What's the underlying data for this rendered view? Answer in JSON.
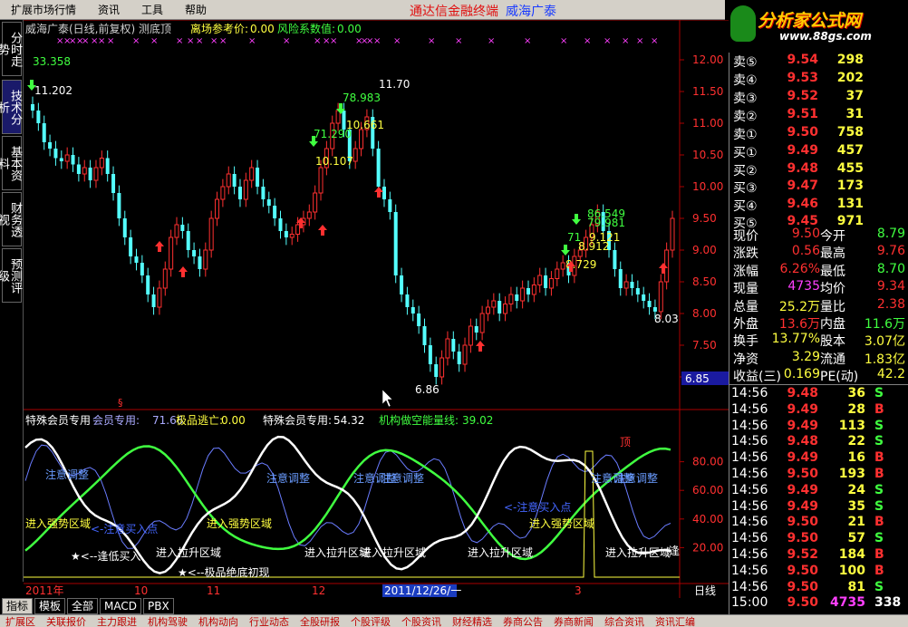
{
  "menu": {
    "items": [
      "扩展市场行情",
      "资讯",
      "工具",
      "帮助"
    ],
    "brand": "通达信金融终端",
    "stock_name": "威海广泰"
  },
  "logo": {
    "text": "分析家公式网",
    "url": "www.88gs.com"
  },
  "left_tabs": [
    "分时走势",
    "技术分析",
    "基本资料",
    "财务透视",
    "预测评级"
  ],
  "chart": {
    "header_title": "威海广泰(日线,前复权) 测底顶",
    "header_line1_label": "离场参考价:",
    "header_line1_value": "0.00",
    "header_line2_label": "风险系数值:",
    "header_line2_value": "0.00",
    "price_axis": [
      "12.00",
      "11.50",
      "11.00",
      "10.50",
      "10.00",
      "9.50",
      "9.00",
      "8.50",
      "8.00",
      "7.50",
      "7.00"
    ],
    "current_price_tag": "6.85",
    "annotations": [
      "33.358",
      "11.202",
      "11.70",
      "78.983",
      "10.661",
      "71.290",
      "10.107",
      "86.549",
      "79.981",
      "9.121",
      "8.912",
      "8.729",
      "71",
      "6.86",
      "8.03"
    ],
    "indicator_title": "特殊会员专用",
    "indicator_line": {
      "label1": "会员专用:",
      "value1": "71.66",
      "label2": "极品逃亡:",
      "value2": "0.00",
      "label3": "特殊会员专用:",
      "value3": "54.32",
      "label4": "机构做空能量线:",
      "value4": "39.02"
    },
    "indicator_axis": [
      "80.00",
      "60.00",
      "40.00",
      "20.00"
    ],
    "indicator_texts": [
      "注意调整",
      "注意调整",
      "注意调整",
      "注意调整",
      "注意调整",
      "注意调整",
      "进入强势区域",
      "进入强势区域",
      "进入强势区域",
      "进入拉升区域",
      "进入拉升区域",
      "进入拉升区域",
      "进入拉升区域",
      "进入拉升区域",
      "<-注意买入点",
      "<-注意买入点",
      "★<--逢低买入",
      "★<--极品绝底初现",
      "顶",
      "逢",
      "§"
    ],
    "date_axis": [
      "2011年",
      "10",
      "11",
      "12",
      "3"
    ],
    "date_selected": "2011/12/26/一",
    "period_label": "日线"
  },
  "quote": {
    "asks": [
      {
        "label": "卖⑤",
        "price": "9.54",
        "vol": "298"
      },
      {
        "label": "卖④",
        "price": "9.53",
        "vol": "202"
      },
      {
        "label": "卖③",
        "price": "9.52",
        "vol": "37"
      },
      {
        "label": "卖②",
        "price": "9.51",
        "vol": "31"
      },
      {
        "label": "卖①",
        "price": "9.50",
        "vol": "758"
      }
    ],
    "bids": [
      {
        "label": "买①",
        "price": "9.49",
        "vol": "457"
      },
      {
        "label": "买②",
        "price": "9.48",
        "vol": "455"
      },
      {
        "label": "买③",
        "price": "9.47",
        "vol": "173"
      },
      {
        "label": "买④",
        "price": "9.46",
        "vol": "131"
      },
      {
        "label": "买⑤",
        "price": "9.45",
        "vol": "971"
      }
    ],
    "stats": [
      {
        "l1": "现价",
        "v1": "9.50",
        "l2": "今开",
        "v2": "8.79",
        "c1": "#ff3030",
        "c2": "#40ff40"
      },
      {
        "l1": "涨跌",
        "v1": "0.56",
        "l2": "最高",
        "v2": "9.76",
        "c1": "#ff3030",
        "c2": "#ff3030"
      },
      {
        "l1": "涨幅",
        "v1": "6.26%",
        "l2": "最低",
        "v2": "8.70",
        "c1": "#ff3030",
        "c2": "#40ff40"
      },
      {
        "l1": "现量",
        "v1": "4735",
        "l2": "均价",
        "v2": "9.34",
        "c1": "#ff40ff",
        "c2": "#ff3030"
      },
      {
        "l1": "总量",
        "v1": "25.2万",
        "l2": "量比",
        "v2": "2.38",
        "c1": "#ffff40",
        "c2": "#ff3030"
      },
      {
        "l1": "外盘",
        "v1": "13.6万",
        "l2": "内盘",
        "v2": "11.6万",
        "c1": "#ff3030",
        "c2": "#40ff40"
      },
      {
        "l1": "换手",
        "v1": "13.77%",
        "l2": "股本",
        "v2": "3.07亿",
        "c1": "#ffff40",
        "c2": "#ffff40"
      },
      {
        "l1": "净资",
        "v1": "3.29",
        "l2": "流通",
        "v2": "1.83亿",
        "c1": "#ffff40",
        "c2": "#ffff40"
      },
      {
        "l1": "收益(三)",
        "v1": "0.169",
        "l2": "PE(动)",
        "v2": "42.2",
        "c1": "#ffff40",
        "c2": "#ffff40"
      }
    ],
    "ticks": [
      {
        "t": "14:56",
        "p": "9.48",
        "v": "36",
        "d": "S"
      },
      {
        "t": "14:56",
        "p": "9.49",
        "v": "28",
        "d": "B"
      },
      {
        "t": "14:56",
        "p": "9.49",
        "v": "113",
        "d": "S"
      },
      {
        "t": "14:56",
        "p": "9.48",
        "v": "22",
        "d": "S"
      },
      {
        "t": "14:56",
        "p": "9.49",
        "v": "16",
        "d": "B"
      },
      {
        "t": "14:56",
        "p": "9.50",
        "v": "193",
        "d": "B"
      },
      {
        "t": "14:56",
        "p": "9.49",
        "v": "24",
        "d": "S"
      },
      {
        "t": "14:56",
        "p": "9.49",
        "v": "35",
        "d": "S"
      },
      {
        "t": "14:56",
        "p": "9.50",
        "v": "21",
        "d": "B"
      },
      {
        "t": "14:56",
        "p": "9.50",
        "v": "57",
        "d": "S"
      },
      {
        "t": "14:56",
        "p": "9.52",
        "v": "184",
        "d": "B"
      },
      {
        "t": "14:56",
        "p": "9.50",
        "v": "100",
        "d": "B"
      },
      {
        "t": "14:56",
        "p": "9.50",
        "v": "81",
        "d": "S"
      },
      {
        "t": "15:00",
        "p": "9.50",
        "v": "4735",
        "d": "338"
      }
    ]
  },
  "bottom_tabs": [
    "指标",
    "模板",
    "全部",
    "MACD",
    "PBX"
  ],
  "status_items": [
    "扩展区",
    "关联报价",
    "主力跟进",
    "机构驾驶",
    "机构动向",
    "行业动态",
    "全股研报",
    "个股评级",
    "个股资讯",
    "财经精选",
    "券商公告",
    "券商新闻",
    "综合资讯",
    "资讯汇编"
  ],
  "colors": {
    "up": "#ff3030",
    "down": "#54ffff",
    "accent": "#ffff40",
    "green_line": "#40ff40"
  }
}
